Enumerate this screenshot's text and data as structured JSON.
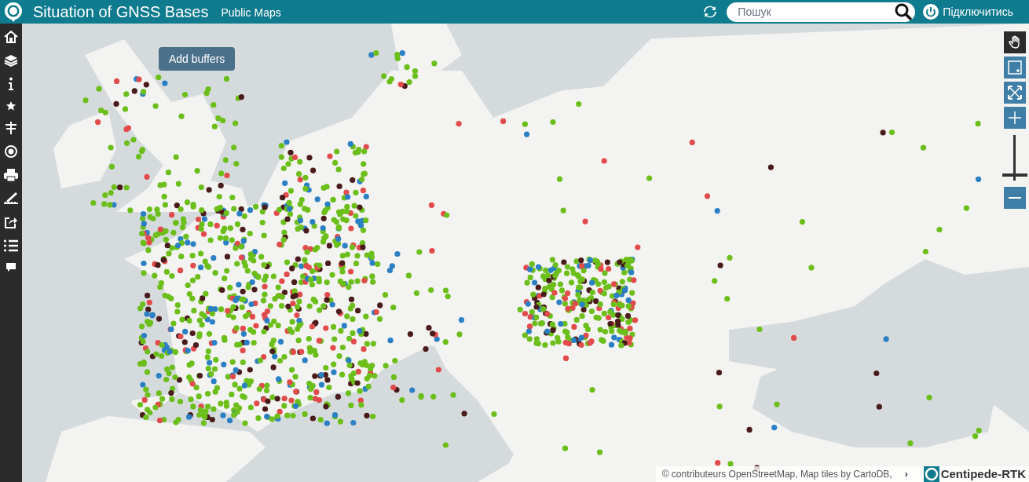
{
  "header": {
    "title": "Situation of GNSS Bases",
    "subtitle": "Public Maps",
    "search": {
      "placeholder": "Пошук"
    },
    "connect": "Підключитись"
  },
  "tooltip": "Add buffers",
  "map_tools": [
    {
      "kind": "pan",
      "selected": true
    },
    {
      "kind": "zoom-box",
      "selected": false
    },
    {
      "kind": "full-extent",
      "selected": false
    },
    {
      "kind": "zoom-in",
      "selected": false
    }
  ],
  "zoom_slider": {
    "level": 0.1
  },
  "zoom_out": {
    "kind": "zoom-out",
    "selected": false
  },
  "attribution": {
    "text": "© contributeurs OpenStreetMap, Map tiles by CartoDB,",
    "toggle": "›",
    "logo": "Centipede-RTK"
  }
}
